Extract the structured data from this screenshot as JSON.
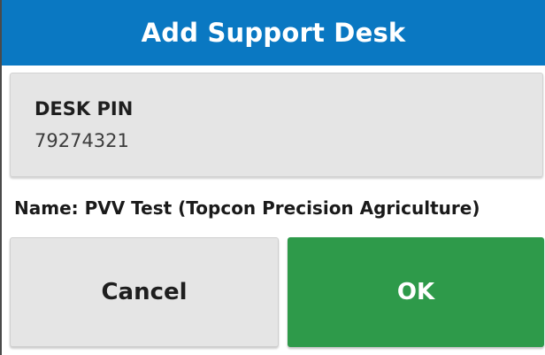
{
  "dialog": {
    "title": "Add Support Desk",
    "pin_label": "DESK PIN",
    "pin_value": "79274321",
    "name_line": "Name: PVV Test (Topcon Precision Agriculture)",
    "cancel_label": "Cancel",
    "ok_label": "OK"
  },
  "colors": {
    "title_bar": "#0a78c2",
    "ok_button": "#2e9a4a",
    "field_background": "#e5e5e5"
  }
}
